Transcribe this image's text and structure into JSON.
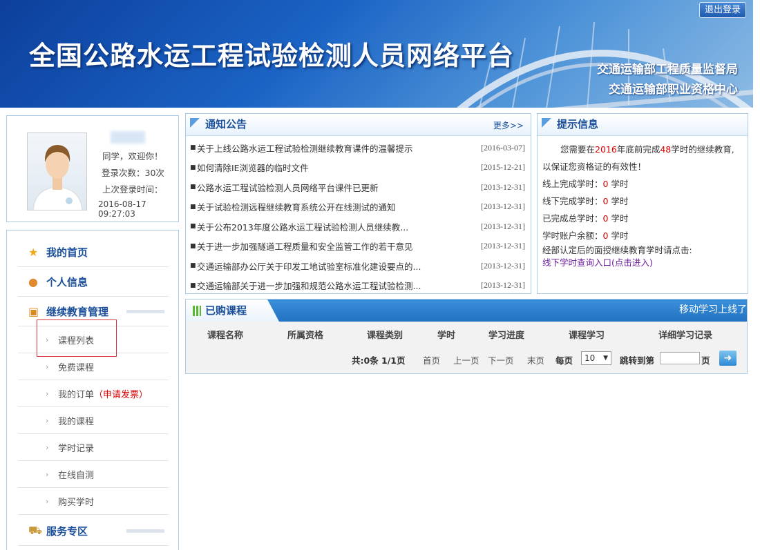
{
  "banner": {
    "title": "全国公路水运工程试验检测人员网络平台",
    "org_line1": "交通运输部工程质量监督局",
    "org_line2": "交通运输部职业资格中心",
    "logout_label": "退出登录"
  },
  "profile": {
    "greeting": "同学，欢迎你！",
    "login_count": "登录次数：30次",
    "last_login_label": "上次登录时间：",
    "last_login_time": "2016-08-17 09:27:03"
  },
  "nav": {
    "home": "我的首页",
    "personal": "个人信息",
    "education": "继续教育管理",
    "sub_items": [
      {
        "label": "课程列表"
      },
      {
        "label": "免费课程"
      },
      {
        "label": "我的订单",
        "extra": "（申请发票）"
      },
      {
        "label": "我的课程"
      },
      {
        "label": "学时记录"
      },
      {
        "label": "在线自测"
      },
      {
        "label": "购买学时"
      }
    ],
    "service": "服务专区"
  },
  "notices": {
    "title": "通知公告",
    "more": "更多>>",
    "items": [
      {
        "text": "关于上线公路水运工程试验检测继续教育课件的温馨提示",
        "date": "[2016-03-07]"
      },
      {
        "text": "如何清除IE浏览器的临时文件",
        "date": "[2015-12-21]"
      },
      {
        "text": "公路水运工程试验检测人员网络平台课件已更新",
        "date": "[2013-12-31]"
      },
      {
        "text": "关于试验检测远程继续教育系统公开在线测试的通知",
        "date": "[2013-12-31]"
      },
      {
        "text": "关于公布2013年度公路水运工程试验检测人员继续教...",
        "date": "[2013-12-31]"
      },
      {
        "text": "关于进一步加强隧道工程质量和安全监管工作的若干意见",
        "date": "[2013-12-31]"
      },
      {
        "text": "交通运输部办公厅关于印发工地试验室标准化建设要点的...",
        "date": "[2013-12-31]"
      },
      {
        "text": "交通运输部关于进一步加强和规范公路水运工程试验检测...",
        "date": "[2013-12-31]"
      }
    ]
  },
  "tips": {
    "title": "提示信息",
    "p1": "您需要在",
    "year": "2016",
    "p2": "年底前完成",
    "hours": "48",
    "p3": "学时的继续教育,以保证您资格证的有效性！",
    "online_label": "线上完成学时：",
    "online_value": "0",
    "offline_label": "线下完成学时：",
    "offline_value": "0",
    "total_label": "已完成总学时：",
    "total_value": "0",
    "balance_label": "学时账户余额：",
    "balance_value": "0",
    "unit": "学时",
    "offline_note": "经部认定后的面授继续教育学时请点击:",
    "offline_link": "线下学时查询入口(点击进入)"
  },
  "courses": {
    "title": "已购课程",
    "mobile_notice": "移动学习上线了",
    "columns": [
      "课程名称",
      "所属资格",
      "课程类别",
      "学时",
      "学习进度",
      "课程学习",
      "详细学习记录"
    ],
    "pager": {
      "summary": "共:0条  1/1页",
      "first": "首页",
      "prev": "上一页",
      "next": "下一页",
      "last": "末页",
      "per_page_label": "每页",
      "per_page_value": "10",
      "jump_label": "跳转到第",
      "page_suffix": "页"
    }
  },
  "colors": {
    "accent": "#1b4f9a",
    "highlight_red": "#d40000",
    "panel_border": "#a9cbe7"
  }
}
